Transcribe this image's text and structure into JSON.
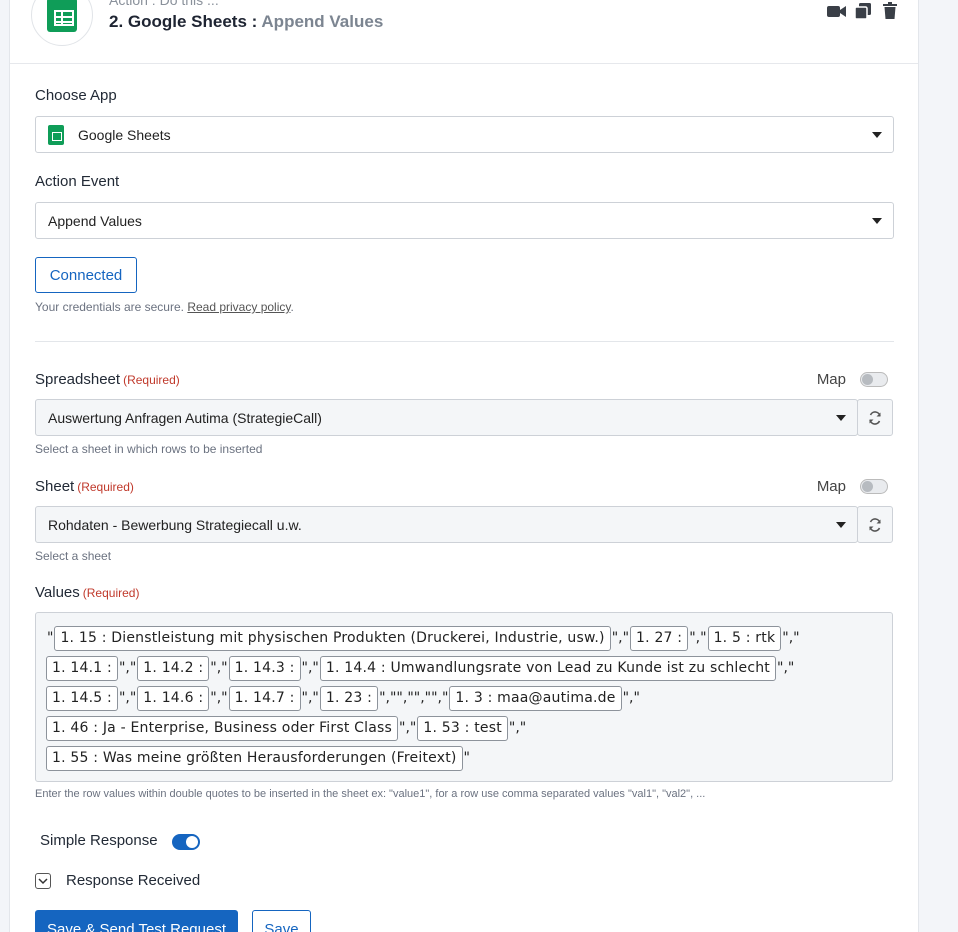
{
  "header": {
    "subtitle": "Action : Do this ...",
    "title": "2. Google Sheets :",
    "event": "Append Values"
  },
  "choose_app": {
    "label": "Choose App",
    "value": "Google Sheets"
  },
  "action_event": {
    "label": "Action Event",
    "value": "Append Values"
  },
  "connection": {
    "button_label": "Connected",
    "secure_text": "Your credentials are secure.",
    "privacy_link": "Read privacy policy",
    "period": "."
  },
  "spreadsheet": {
    "label": "Spreadsheet",
    "required": "(Required)",
    "map_label": "Map",
    "value": "Auswertung Anfragen Autima (StrategieCall)",
    "hint": "Select a sheet in which rows to be inserted"
  },
  "sheet": {
    "label": "Sheet",
    "required": "(Required)",
    "map_label": "Map",
    "value": "Rohdaten - Bewerbung Strategiecall u.w.",
    "hint": "Select a sheet"
  },
  "values": {
    "label": "Values",
    "required": "(Required)",
    "hint": "Enter the row values within double quotes to be inserted in the sheet ex: \"value1\", for a row use comma separated values \"val1\", \"val2\", ...",
    "line1": {
      "q0": "\"",
      "t1": "1. 15 : Dienstleistung mit physischen Produkten (Druckerei, Industrie, usw.)",
      "q1": "\",\"",
      "t2": "1. 27 :",
      "q2": "\",\"",
      "t3": "1. 5 : rtk",
      "q3": "\",\""
    },
    "line2": {
      "t1": "1. 14.1 :",
      "q1": "\",\"",
      "t2": "1. 14.2 :",
      "q2": "\",\"",
      "t3": "1. 14.3 :",
      "q3": "\",\"",
      "t4": "1. 14.4 : Umwandlungsrate von Lead zu Kunde ist zu schlecht",
      "q4": "\",\""
    },
    "line3": {
      "t1": "1. 14.5 :",
      "q1": "\",\"",
      "t2": "1. 14.6 :",
      "q2": "\",\"",
      "t3": "1. 14.7 :",
      "q3": "\",\"",
      "t4": "1. 23 :",
      "q4": "\",\"\",\"\",\"\",\"",
      "t5": "1. 3 : maa@autima.de",
      "q5": "\",\""
    },
    "line4": {
      "t1": "1. 46 : Ja - Enterprise, Business oder First Class",
      "q1": "\",\"",
      "t2": "1. 53 : test",
      "q2": "\",\""
    },
    "line5": {
      "t1": "1. 55 : Was meine größten Herausforderungen (Freitext)",
      "q1": "\""
    }
  },
  "simple_response": {
    "label": "Simple Response",
    "enabled": true
  },
  "response_received": {
    "label": "Response Received"
  },
  "buttons": {
    "save_test": "Save & Send Test Request",
    "save": "Save"
  },
  "colors": {
    "primary": "#1565c0",
    "sheets_green": "#0f9d58",
    "required": "#c0392b"
  }
}
